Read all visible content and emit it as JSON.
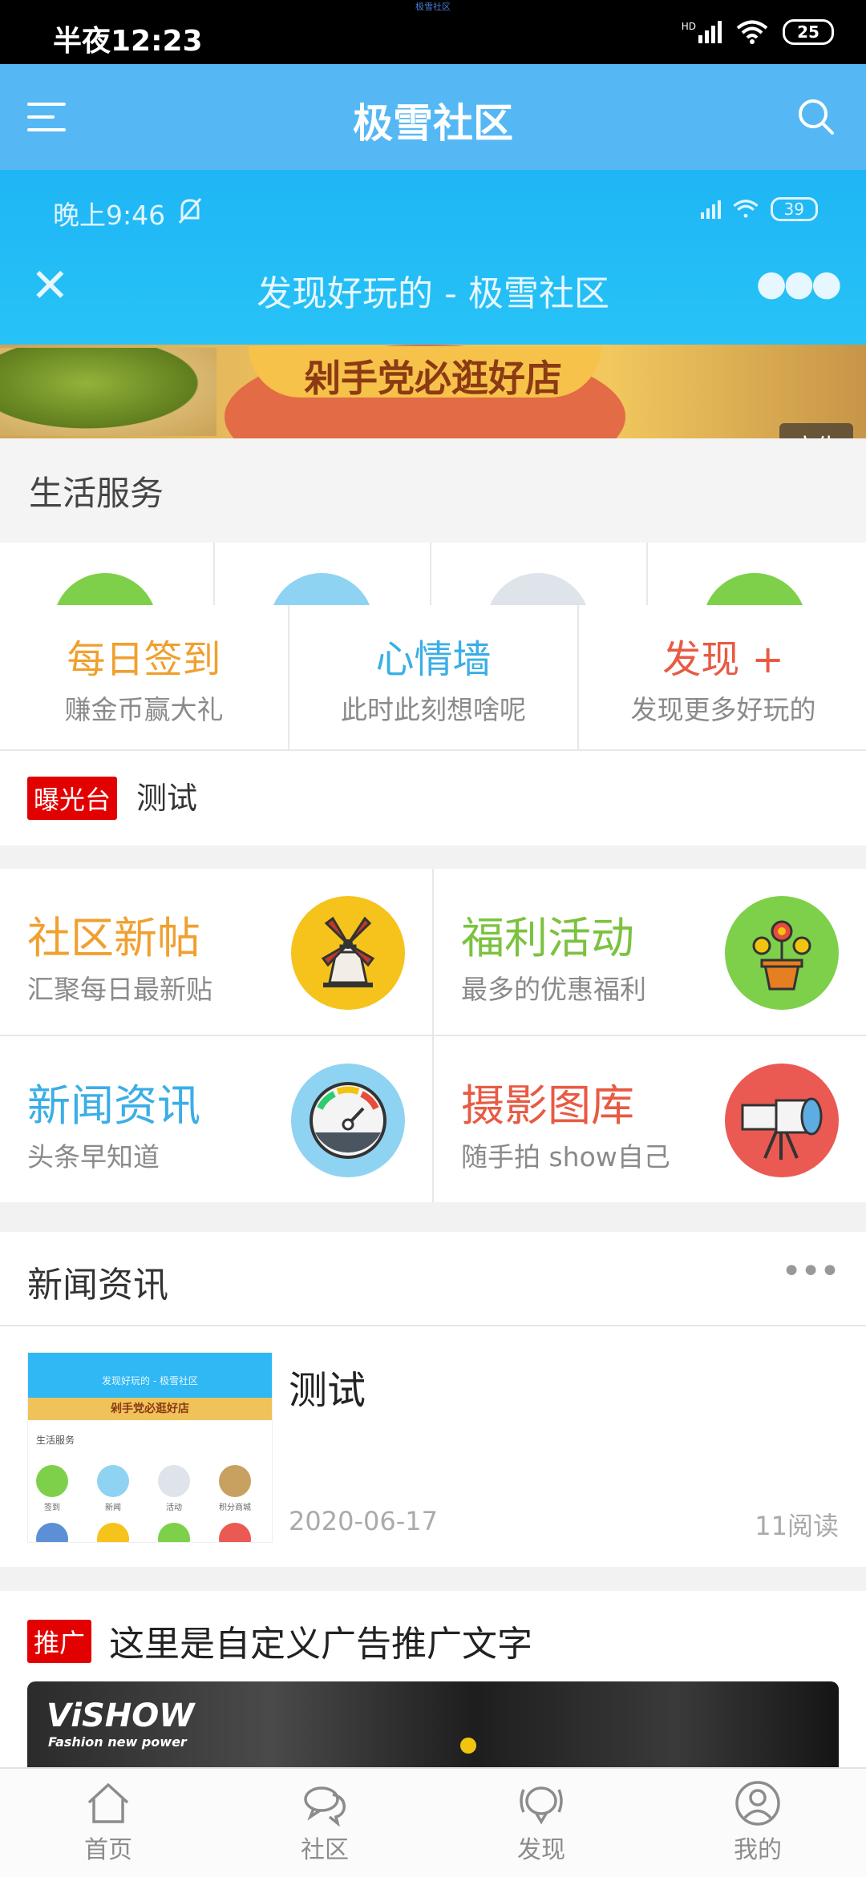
{
  "status_bar": {
    "time": "半夜12:23",
    "battery": "25",
    "network": "HD",
    "tiny_label": "极雪社区"
  },
  "app_bar": {
    "title": "极雪社区"
  },
  "banner": {
    "inner_time": "晚上9:46",
    "inner_title": "发现好玩的 - 极雪社区",
    "inner_battery": "39",
    "promo_text": "剁手党必逛好店",
    "ad_badge": "广告"
  },
  "life_section": {
    "label": "生活服务"
  },
  "quick_actions": [
    {
      "title": "每日签到",
      "subtitle": "赚金币赢大礼",
      "color": "#f0a030"
    },
    {
      "title": "心情墙",
      "subtitle": "此时此刻想啥呢",
      "color": "#3aaee6"
    },
    {
      "title": "发现 +",
      "subtitle": "发现更多好玩的",
      "color": "#e85a43"
    }
  ],
  "exposure": {
    "tag": "曝光台",
    "text": "测试"
  },
  "features": [
    {
      "title": "社区新帖",
      "subtitle": "汇聚每日最新贴",
      "color": "#f0a030",
      "icon": "windmill-icon",
      "icon_bg": "#f5c31b"
    },
    {
      "title": "福利活动",
      "subtitle": "最多的优惠福利",
      "color": "#7cc23f",
      "icon": "flower-pot-icon",
      "icon_bg": "#7ed04a"
    },
    {
      "title": "新闻资讯",
      "subtitle": "头条早知道",
      "color": "#3aaee6",
      "icon": "gauge-icon",
      "icon_bg": "#8fd3f2"
    },
    {
      "title": "摄影图库",
      "subtitle": "随手拍 show自己",
      "color": "#e85a43",
      "icon": "camera-icon",
      "icon_bg": "#ea5a52"
    }
  ],
  "news": {
    "header": "新闻资讯",
    "item": {
      "title": "测试",
      "date": "2020-06-17",
      "reads": "11阅读",
      "thumb_title": "发现好玩的 - 极雪社区",
      "thumb_banner": "剁手党必逛好店",
      "thumb_section": "生活服务",
      "thumb_captions": [
        "签到",
        "新闻",
        "活动",
        "积分商城"
      ]
    }
  },
  "promo": {
    "tag": "推广",
    "text": "这里是自定义广告推广文字",
    "brand": "ViSHOW",
    "brand_sub": "Fashion new power"
  },
  "tab_bar": [
    {
      "label": "首页",
      "icon": "home-icon"
    },
    {
      "label": "社区",
      "icon": "chat-icon"
    },
    {
      "label": "发现",
      "icon": "discover-icon"
    },
    {
      "label": "我的",
      "icon": "user-icon"
    }
  ]
}
